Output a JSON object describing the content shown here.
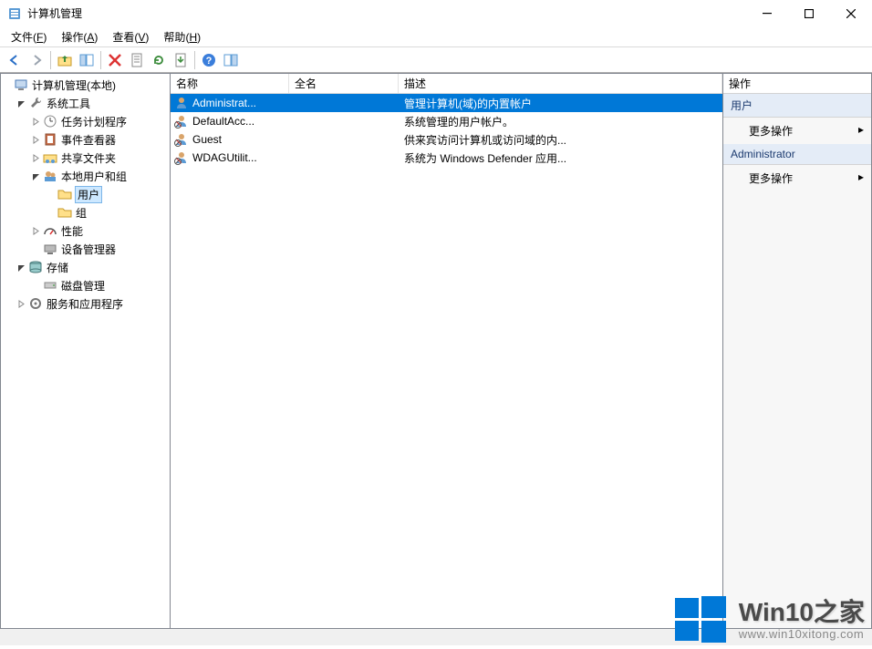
{
  "window": {
    "title": "计算机管理"
  },
  "menu": {
    "file": {
      "label": "文件",
      "hotkey": "F"
    },
    "action": {
      "label": "操作",
      "hotkey": "A"
    },
    "view": {
      "label": "查看",
      "hotkey": "V"
    },
    "help": {
      "label": "帮助",
      "hotkey": "H"
    }
  },
  "tree": {
    "root": {
      "label": "计算机管理(本地)"
    },
    "systools": {
      "label": "系统工具"
    },
    "tasksched": {
      "label": "任务计划程序"
    },
    "eventvwr": {
      "label": "事件查看器"
    },
    "shared": {
      "label": "共享文件夹"
    },
    "lusrmgr": {
      "label": "本地用户和组"
    },
    "users": {
      "label": "用户"
    },
    "groups": {
      "label": "组"
    },
    "perf": {
      "label": "性能"
    },
    "devmgr": {
      "label": "设备管理器"
    },
    "storage": {
      "label": "存储"
    },
    "diskmgr": {
      "label": "磁盘管理"
    },
    "services": {
      "label": "服务和应用程序"
    }
  },
  "list": {
    "headers": {
      "name": "名称",
      "fullname": "全名",
      "desc": "描述"
    },
    "rows": [
      {
        "name": "Administrat...",
        "fullname": "",
        "desc": "管理计算机(域)的内置帐户",
        "selected": true,
        "disabled": false
      },
      {
        "name": "DefaultAcc...",
        "fullname": "",
        "desc": "系统管理的用户帐户。",
        "selected": false,
        "disabled": true
      },
      {
        "name": "Guest",
        "fullname": "",
        "desc": "供来宾访问计算机或访问域的内...",
        "selected": false,
        "disabled": true
      },
      {
        "name": "WDAGUtilit...",
        "fullname": "",
        "desc": "系统为 Windows Defender 应用...",
        "selected": false,
        "disabled": true
      }
    ]
  },
  "actions": {
    "header": "操作",
    "group1": {
      "title": "用户",
      "more": "更多操作"
    },
    "group2": {
      "title": "Administrator",
      "more": "更多操作"
    }
  },
  "watermark": {
    "big": "Win10之家",
    "small": "www.win10xitong.com"
  }
}
